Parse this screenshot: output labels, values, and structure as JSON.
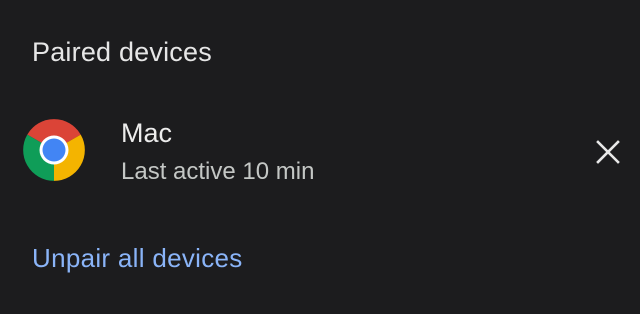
{
  "section": {
    "title": "Paired devices"
  },
  "device": {
    "name": "Mac",
    "status": "Last active 10 min",
    "icon": "chrome-logo-icon"
  },
  "actions": {
    "remove_icon": "close-icon",
    "unpair_all_label": "Unpair all devices"
  },
  "colors": {
    "background": "#1c1c1e",
    "link": "#8ab4f8",
    "text_primary": "#ececec",
    "text_secondary": "#c4c7c5"
  }
}
